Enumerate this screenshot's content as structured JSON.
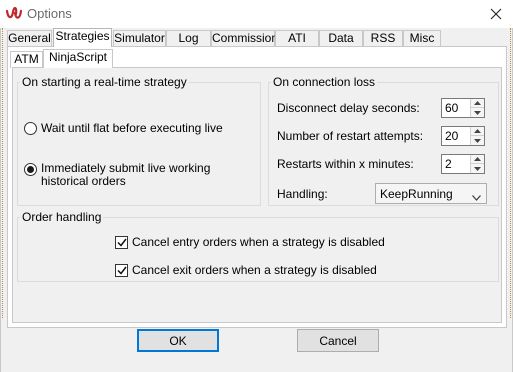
{
  "window": {
    "title": "Options",
    "app_icon": "ninjatrader-logo-icon",
    "close_icon": "close-icon"
  },
  "tabs": [
    {
      "label": "General",
      "active": false
    },
    {
      "label": "Strategies",
      "active": true
    },
    {
      "label": "Simulator",
      "active": false
    },
    {
      "label": "Log",
      "active": false
    },
    {
      "label": "Commission",
      "active": false
    },
    {
      "label": "ATI",
      "active": false
    },
    {
      "label": "Data",
      "active": false
    },
    {
      "label": "RSS",
      "active": false
    },
    {
      "label": "Misc",
      "active": false
    }
  ],
  "sub_tabs": [
    {
      "label": "ATM",
      "active": false
    },
    {
      "label": "NinjaScript",
      "active": true
    }
  ],
  "realtime": {
    "legend": "On starting a real-time strategy",
    "option_wait": "Wait until flat before executing live",
    "option_wait_checked": false,
    "option_submit_line1": "Immediately submit live working",
    "option_submit_line2": "historical orders",
    "option_submit_checked": true
  },
  "connection": {
    "legend": "On connection loss",
    "disconnect_label": "Disconnect delay seconds:",
    "disconnect_value": "60",
    "restart_attempts_label": "Number of restart attempts:",
    "restart_attempts_value": "20",
    "restart_minutes_label": "Restarts within x minutes:",
    "restart_minutes_value": "2",
    "handling_label": "Handling:",
    "handling_value": "KeepRunning"
  },
  "order_handling": {
    "legend": "Order handling",
    "cancel_entry_label": "Cancel entry orders when a strategy is disabled",
    "cancel_entry_checked": true,
    "cancel_exit_label": "Cancel exit orders when a strategy is disabled",
    "cancel_exit_checked": true
  },
  "buttons": {
    "ok": "OK",
    "cancel": "Cancel"
  },
  "colors": {
    "logo_red": "#c0282d",
    "default_button_border": "#0078d7"
  }
}
